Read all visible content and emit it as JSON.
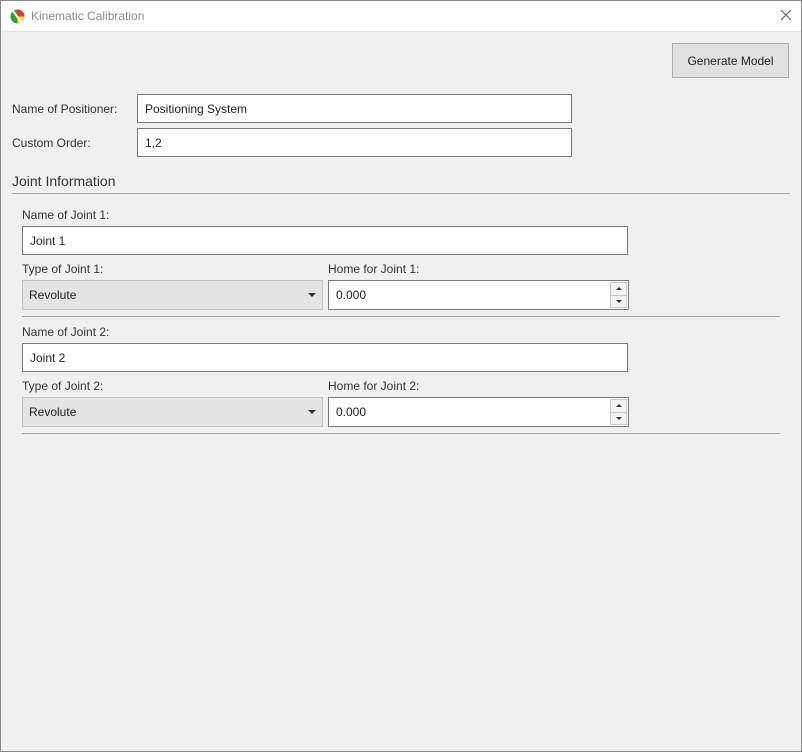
{
  "window": {
    "title": "Kinematic Calibration",
    "app_icon": "colorful-circle-icon",
    "close_icon": "close-icon"
  },
  "toolbar": {
    "generate_label": "Generate Model"
  },
  "positioner": {
    "name_label": "Name of Positioner:",
    "name_value": "Positioning System",
    "order_label": "Custom Order:",
    "order_value": "1,2"
  },
  "joint_section": {
    "title": "Joint Information"
  },
  "joints": [
    {
      "name_label": "Name of Joint 1:",
      "name_value": "Joint 1",
      "type_label": "Type of Joint 1:",
      "type_value": "Revolute",
      "home_label": "Home for Joint 1:",
      "home_value": "0.000"
    },
    {
      "name_label": "Name of Joint 2:",
      "name_value": "Joint 2",
      "type_label": "Type of Joint 2:",
      "type_value": "Revolute",
      "home_label": "Home for Joint 2:",
      "home_value": "0.000"
    }
  ]
}
